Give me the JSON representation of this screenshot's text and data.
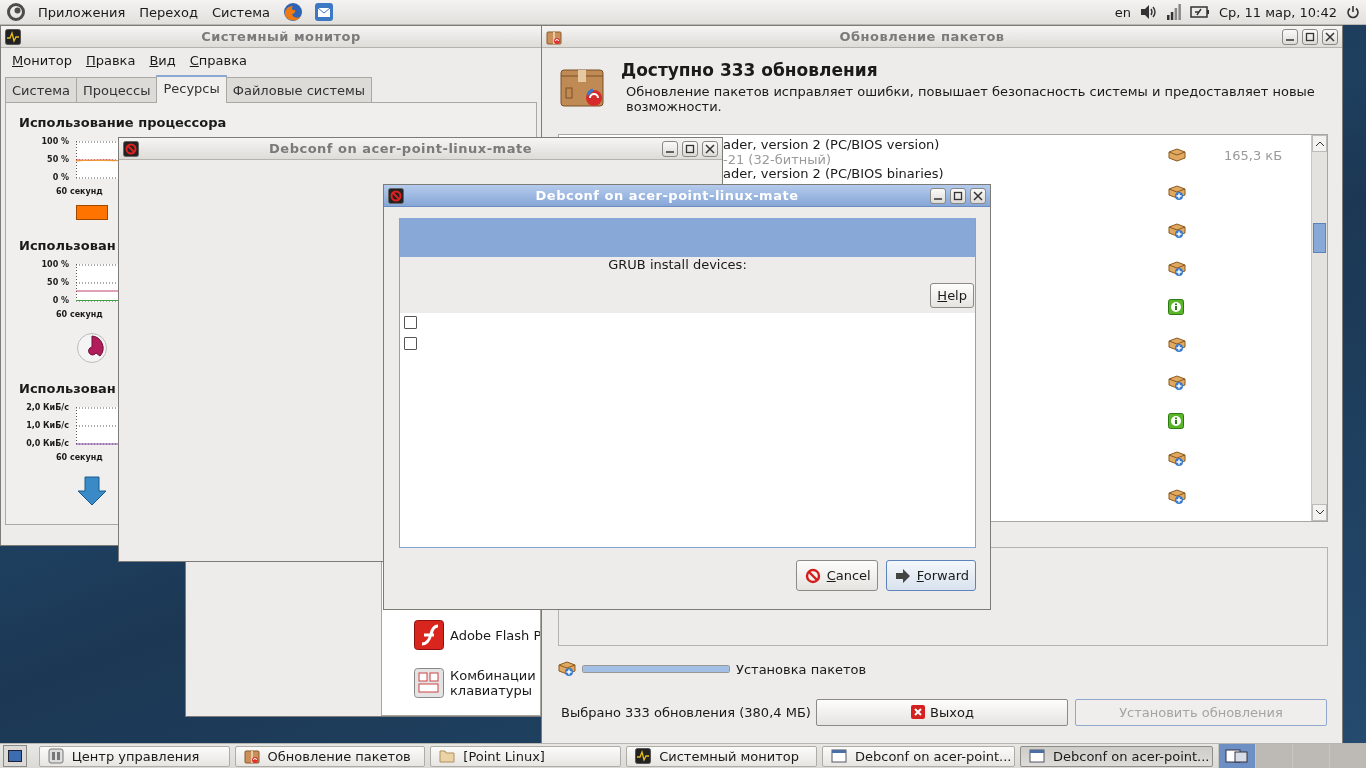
{
  "top_panel": {
    "menus": [
      "Приложения",
      "Переход",
      "Система"
    ],
    "layout": "en",
    "clock": "Ср, 11 мар, 10:42"
  },
  "system_monitor": {
    "title": "Системный монитор",
    "active": false,
    "menu": [
      "Монитор",
      "Правка",
      "Вид",
      "Справка"
    ],
    "tabs": [
      {
        "label": "Система",
        "selected": false
      },
      {
        "label": "Процессы",
        "selected": false
      },
      {
        "label": "Ресурсы",
        "selected": true
      },
      {
        "label": "Файловые системы",
        "selected": false
      }
    ],
    "sections": [
      {
        "kind": "cpu",
        "heading": "Использование процессора",
        "yticks": [
          "100 %",
          "50 %",
          "0 %"
        ],
        "xlabel": "60 секунд"
      },
      {
        "kind": "memory",
        "heading": "Использован",
        "yticks": [
          "100 %",
          "50 %",
          "0 %"
        ],
        "xlabel": "60 секунд"
      },
      {
        "kind": "network",
        "heading": "Использован",
        "yticks": [
          "2,0 КиБ/с",
          "1,0 КиБ/с",
          "0,0 КиБ/с"
        ],
        "xlabel": "60 секунд"
      }
    ]
  },
  "control_center": {
    "items": [
      {
        "kind": "flash",
        "lines": [
          "Adobe Flash P"
        ]
      },
      {
        "kind": "keyboard",
        "lines": [
          "Комбинации",
          "клавиатуры"
        ]
      }
    ]
  },
  "updates": {
    "title": "Обновление пакетов",
    "active": false,
    "heading": "Доступно 333 обновления",
    "description": "Обновление пакетов исправляет ошибки, повышает безопасность системы и предоставляет новые возможности.",
    "packages": [
      {
        "kind": "package",
        "name": "ader, version 2 (PC/BIOS version)",
        "version": "-21 (32-битный)",
        "size": "165,3 кБ"
      },
      {
        "kind": "new",
        "name": "ader, version 2 (PC/BIOS binaries)"
      },
      {
        "kind": "new"
      },
      {
        "kind": "new"
      },
      {
        "kind": "info"
      },
      {
        "kind": "new"
      },
      {
        "kind": "new"
      },
      {
        "kind": "info"
      },
      {
        "kind": "new"
      },
      {
        "kind": "new"
      }
    ],
    "progress": {
      "level": 1,
      "label": "Установка пакетов"
    },
    "summary": "Выбрано 333 обновления (380,4 МБ)",
    "quit_button": "Выход",
    "install_button": {
      "label": "Установить обновления",
      "disabled": true
    }
  },
  "debconf_back": {
    "title": "Debconf on acer-point-linux-mate",
    "active": false
  },
  "debconf_dialog": {
    "title": "Debconf on acer-point-linux-mate",
    "active": true,
    "question": "GRUB install devices:",
    "help_button": "Help",
    "choices": [
      {
        "checked": false
      },
      {
        "checked": false
      }
    ],
    "buttons": [
      {
        "kind": "cancel",
        "label": "Cancel",
        "focused": false
      },
      {
        "kind": "forward",
        "label": "Forward",
        "focused": true
      }
    ]
  },
  "taskbar": {
    "tasks": [
      {
        "kind": "control",
        "label": "Центр управления",
        "selected": false
      },
      {
        "kind": "package",
        "label": "Обновление пакетов",
        "selected": false
      },
      {
        "kind": "folder",
        "label": "[Point Linux]",
        "selected": false
      },
      {
        "kind": "monitor",
        "label": "Системный монитор",
        "selected": false
      },
      {
        "kind": "window",
        "label": "Debconf on acer-point...",
        "selected": false
      },
      {
        "kind": "window",
        "label": "Debconf on acer-point...",
        "selected": true
      }
    ]
  }
}
